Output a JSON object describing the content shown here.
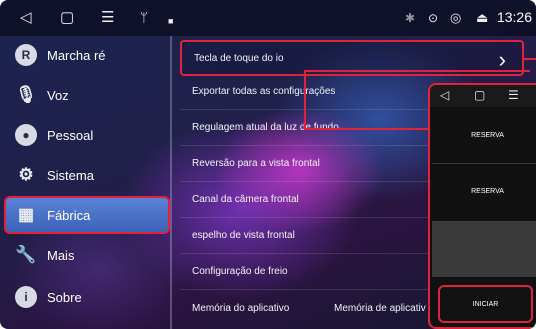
{
  "statusbar": {
    "nav_icons": [
      "back-icon",
      "home-icon",
      "menu-icon",
      "usb-icon",
      "notification-icon"
    ],
    "status_icons": [
      "bluetooth-icon",
      "location-icon",
      "wifi-icon",
      "eject-icon"
    ],
    "time": "13:26"
  },
  "sidebar": {
    "items": [
      {
        "label": "Marcha ré",
        "icon": "R"
      },
      {
        "label": "Voz",
        "icon": "microphone-icon"
      },
      {
        "label": "Pessoal",
        "icon": "person-icon"
      },
      {
        "label": "Sistema",
        "icon": "gears-icon"
      },
      {
        "label": "Fábrica",
        "icon": "factory-icon",
        "active": true
      },
      {
        "label": "Mais",
        "icon": "wrench-icon"
      },
      {
        "label": "Sobre",
        "icon": "info-icon"
      }
    ]
  },
  "list": {
    "items": [
      {
        "label": "Tecla de toque do io",
        "highlight": true
      },
      {
        "label": "Exportar todas as configurações"
      },
      {
        "label": "Regulagem atual da luz de fundo"
      },
      {
        "label": "Reversão para a vista frontal"
      },
      {
        "label": "Canal da câmera frontal"
      },
      {
        "label": "espelho de vista frontal"
      },
      {
        "label": "Configuração de freio"
      },
      {
        "label": "Memória do aplicativo",
        "value": "Memória de aplicativ"
      }
    ]
  },
  "phone": {
    "tiles": [
      "RESERVA",
      "RESERVA"
    ],
    "start_label": "INICIAR"
  },
  "colors": {
    "accent_red": "#e0223a",
    "active_blue": "#4a72c8"
  }
}
